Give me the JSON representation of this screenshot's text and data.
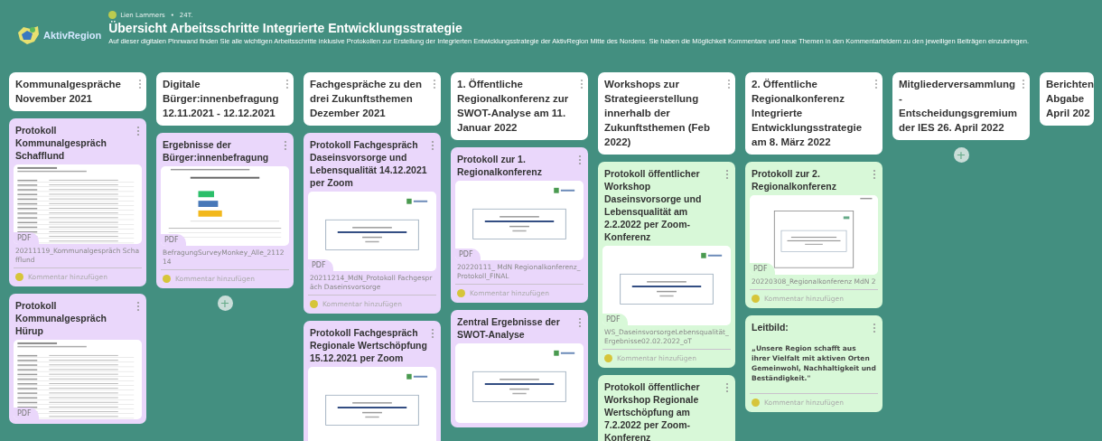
{
  "header": {
    "logo_text": "AktivRegion",
    "author": "Lien Lammers",
    "separator": "•",
    "age": "24T.",
    "title": "Übersicht Arbeitsschritte Integrierte Entwicklungsstrategie",
    "description": "Auf dieser digitalen Pinnwand finden Sie alle wichtigen Arbeitsschritte inklusive Protokollen zur Erstellung der Integrierten Entwicklungsstrategie der AktivRegion Mitte des Nordens. Sie haben die Möglichkeit Kommentare und neue Themen in den Kommentarfeldern zu den jeweiligen Beiträgen einzubringen."
  },
  "columns": [
    {
      "title": "Kommunalgespräche November 2021",
      "cards": [
        {
          "kind": "attachment",
          "color": "#ead7fb",
          "title": "Protokoll Kommunalgespräch Schafflund",
          "preview": {
            "kind": "table"
          },
          "badge": "PDF",
          "file": "20211119_Kommunalgespräch Schafflund",
          "comment": "Kommentar hinzufügen"
        },
        {
          "kind": "attachment",
          "color": "#ead7fb",
          "title": "Protokoll Kommunalgespräch Hürup",
          "preview": {
            "kind": "table"
          },
          "badge": "PDF"
        }
      ]
    },
    {
      "title": "Digitale Bürger:innenbefragung 12.11.2021 - 12.12.2021",
      "add": "+",
      "cards": [
        {
          "kind": "attachment",
          "color": "#ead7fb",
          "title": "Ergebnisse der Bürger:innenbefragung",
          "preview": {
            "kind": "chart"
          },
          "badge": "PDF",
          "file": "BefragungSurveyMonkey_Alle_211214",
          "comment": "Kommentar hinzufügen"
        }
      ]
    },
    {
      "title": "Fachgespräche zu den drei Zukunftsthemen Dezember 2021",
      "cards": [
        {
          "kind": "attachment",
          "color": "#ead7fb",
          "title": "Protokoll Fachgespräch Daseinsvorsorge und Lebensqualität 14.12.2021 per Zoom",
          "preview": {
            "kind": "slide"
          },
          "badge": "PDF",
          "file": "20211214_MdN_Protokoll Fachgespräch Daseinsvorsorge",
          "comment": "Kommentar hinzufügen"
        },
        {
          "kind": "attachment",
          "color": "#ead7fb",
          "title": "Protokoll Fachgespräch Regionale Wertschöpfung 15.12.2021 per Zoom",
          "preview": {
            "kind": "slide"
          }
        }
      ]
    },
    {
      "title": "1. Öffentliche Regionalkonferenz zur SWOT-Analyse am 11. Januar 2022",
      "cards": [
        {
          "kind": "attachment",
          "color": "#ead7fb",
          "title": "Protokoll zur 1. Regionalkonferenz",
          "preview": {
            "kind": "slide"
          },
          "badge": "PDF",
          "file": "20220111_ MdN Regionalkonferenz_Protokoll_FINAL",
          "comment": "Kommentar hinzufügen"
        },
        {
          "kind": "attachment",
          "color": "#ead7fb",
          "title": "Zentral Ergebnisse der SWOT-Analyse",
          "preview": {
            "kind": "slide"
          }
        }
      ]
    },
    {
      "title": "Workshops zur Strategieerstellung innerhalb der Zukunftsthemen (Feb 2022)",
      "cards": [
        {
          "kind": "attachment",
          "color": "#d8f8d8",
          "title": "Protokoll öffentlicher Workshop Daseinsvorsorge und Lebensqualität am 2.2.2022 per Zoom-Konferenz",
          "preview": {
            "kind": "slide"
          },
          "badge": "PDF",
          "file": "WS_DaseinsvorsorgeLebensqualität_Ergebnisse02.02.2022_oT",
          "comment": "Kommentar hinzufügen"
        },
        {
          "kind": "attachment",
          "color": "#d8f8d8",
          "title": "Protokoll öffentlicher Workshop Regionale Wertschöpfung am 7.2.2022 per Zoom-Konferenz"
        }
      ]
    },
    {
      "title": "2. Öffentliche Regionalkonferenz Integrierte Entwicklungsstrategie am 8. März 2022",
      "cards": [
        {
          "kind": "attachment",
          "color": "#d8f8d8",
          "title": "Protokoll zur 2. Regionalkonferenz",
          "preview": {
            "kind": "framed"
          },
          "badge": "PDF",
          "file": "20220308_Regionalkonferenz MdN 2",
          "comment": "Kommentar hinzufügen"
        },
        {
          "kind": "note",
          "color": "#d8f8d8",
          "title": "Leitbild:",
          "body": "„Unsere Region schafft aus ihrer Vielfalt mit aktiven Orten Gemeinwohl, Nachhaltigkeit und Beständigkeit.\"",
          "comment": "Kommentar hinzufügen"
        }
      ]
    },
    {
      "title": "Mitgliederversammlung - Entscheidungsgremium der IES 26. April 2022",
      "add": "+"
    },
    {
      "title": "Berichten Abgabe April 202",
      "partial": true
    }
  ]
}
